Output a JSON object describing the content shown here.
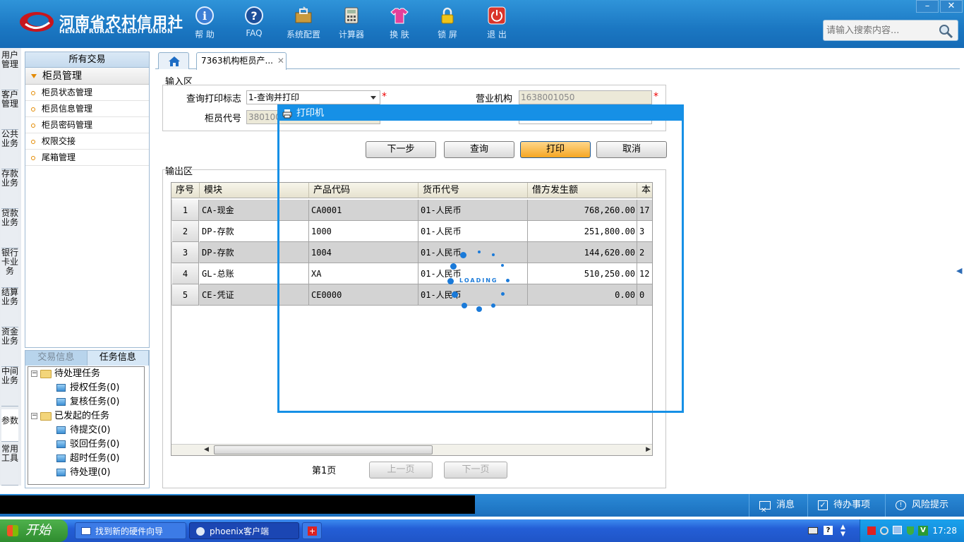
{
  "header": {
    "logo_cn": "河南省农村信用社",
    "logo_en": "HENAN RURAL CREDIT UNION",
    "tools": [
      "帮 助",
      "FAQ",
      "系统配置",
      "计算器",
      "换 肤",
      "锁 屏",
      "退 出"
    ],
    "search_placeholder": "请输入搜索内容...",
    "minimize": "–",
    "close": "✕"
  },
  "vertical_tabs": [
    "用户管理",
    "客户管理",
    "公共业务",
    "存款业务",
    "贷款业务",
    "银行卡业务",
    "结算业务",
    "资金业务",
    "中间业务",
    "参数",
    "常用工具"
  ],
  "left_panel": {
    "title": "所有交易",
    "group": "柜员管理",
    "items": [
      "柜员状态管理",
      "柜员信息管理",
      "柜员密码管理",
      "权限交接",
      "尾箱管理"
    ]
  },
  "task_panel": {
    "tabs": [
      "交易信息",
      "任务信息"
    ],
    "tree": [
      {
        "label": "待处理任务",
        "children": [
          "授权任务(0)",
          "复核任务(0)"
        ]
      },
      {
        "label": "已发起的任务",
        "children": [
          "待提交(0)",
          "驳回任务(0)",
          "超时任务(0)",
          "待处理(0)"
        ]
      }
    ]
  },
  "tabs": {
    "active_label": "7363机构柜员产..."
  },
  "input_area": {
    "label": "输入区",
    "print_flag_label": "查询打印标志",
    "print_flag_value": "1-查询并打印",
    "org_label": "营业机构",
    "org_value": "1638001050",
    "teller_label": "柜员代号",
    "teller_value": "380100"
  },
  "buttons": {
    "next": "下一步",
    "query": "查询",
    "print": "打印",
    "cancel": "取消"
  },
  "output_area": {
    "label": "输出区",
    "columns": [
      "序号",
      "模块",
      "产品代码",
      "货币代号",
      "借方发生额",
      "本"
    ],
    "rows": [
      {
        "idx": "1",
        "module": "CA-现金",
        "product": "CA0001",
        "currency": "01-人民币",
        "debit": "768,260.00",
        "extra": "17"
      },
      {
        "idx": "2",
        "module": "DP-存款",
        "product": "1000",
        "currency": "01-人民币",
        "debit": "251,800.00",
        "extra": "3"
      },
      {
        "idx": "3",
        "module": "DP-存款",
        "product": "1004",
        "currency": "01-人民币",
        "debit": "144,620.00",
        "extra": "2"
      },
      {
        "idx": "4",
        "module": "GL-总账",
        "product": "XA",
        "currency": "01-人民币",
        "debit": "510,250.00",
        "extra": "12"
      },
      {
        "idx": "5",
        "module": "CE-凭证",
        "product": "CE0000",
        "currency": "01-人民币",
        "debit": "0.00",
        "extra": "0"
      }
    ],
    "page": "第1页",
    "prev": "上一页",
    "next": "下一页"
  },
  "dialog": {
    "title": "打印机",
    "loading": "LOADING"
  },
  "statusbar": {
    "messages": "消息",
    "todo": "待办事项",
    "risk": "风险提示"
  },
  "taskbar": {
    "start": "开始",
    "items": [
      "找到新的硬件向导",
      "phoenix客户端"
    ],
    "time": "17:28"
  },
  "colors": {
    "header_blue": "#1b77c2",
    "dialog_blue": "#1690e6",
    "print_orange": "#f5a623",
    "required_red": "#e00000"
  }
}
